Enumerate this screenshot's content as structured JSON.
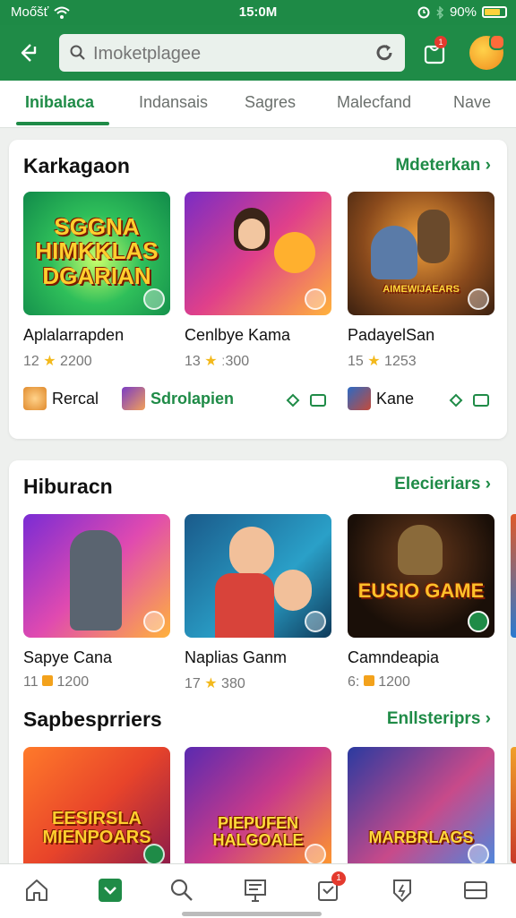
{
  "status": {
    "carrier": "Moőšť",
    "time": "15:0M",
    "battery": "90%"
  },
  "search": {
    "placeholder": "Imoketplagee"
  },
  "notification_badge": "1",
  "tabs": [
    "Inibalaca",
    "Indansais",
    "Sagres",
    "Malecfand",
    "Nave"
  ],
  "sections": [
    {
      "title": "Karkagaon",
      "link": "Mdeterkan",
      "games": [
        {
          "name": "Aplalarrapden",
          "rating": "12",
          "count": "2200",
          "overlay": "SGGNA HIMKKLAS DGARIAN"
        },
        {
          "name": "Cenlbye Kama",
          "rating": "13",
          "count": "ː300",
          "overlay": ""
        },
        {
          "name": "PadayelSan",
          "rating": "15",
          "count": "1253",
          "overlay": "AIMEWIJAEARS"
        }
      ],
      "chips": [
        "Rercal",
        "Sdrolapien",
        "Kane"
      ]
    },
    {
      "title": "Hiburacn",
      "link": "Elecieriars",
      "games": [
        {
          "name": "Sapye Cana",
          "rating": "11",
          "count": "1200",
          "overlay": ""
        },
        {
          "name": "Naplias Ganm",
          "rating": "17",
          "count": "380",
          "overlay": ""
        },
        {
          "name": "Camndeapia",
          "rating": "6:",
          "count": "1200",
          "overlay": "EUSIO GAME"
        }
      ]
    },
    {
      "title": "Sapbesprriers",
      "link": "Enllsteriprs",
      "games": [
        {
          "overlay": "EESIRSLA MIENPOARS"
        },
        {
          "overlay": "PIEPUFEN HALGOALE"
        },
        {
          "overlay": "MARBRLAGS"
        }
      ]
    }
  ],
  "colors": {
    "brand": "#1f8b47",
    "star": "#f3b91c"
  }
}
